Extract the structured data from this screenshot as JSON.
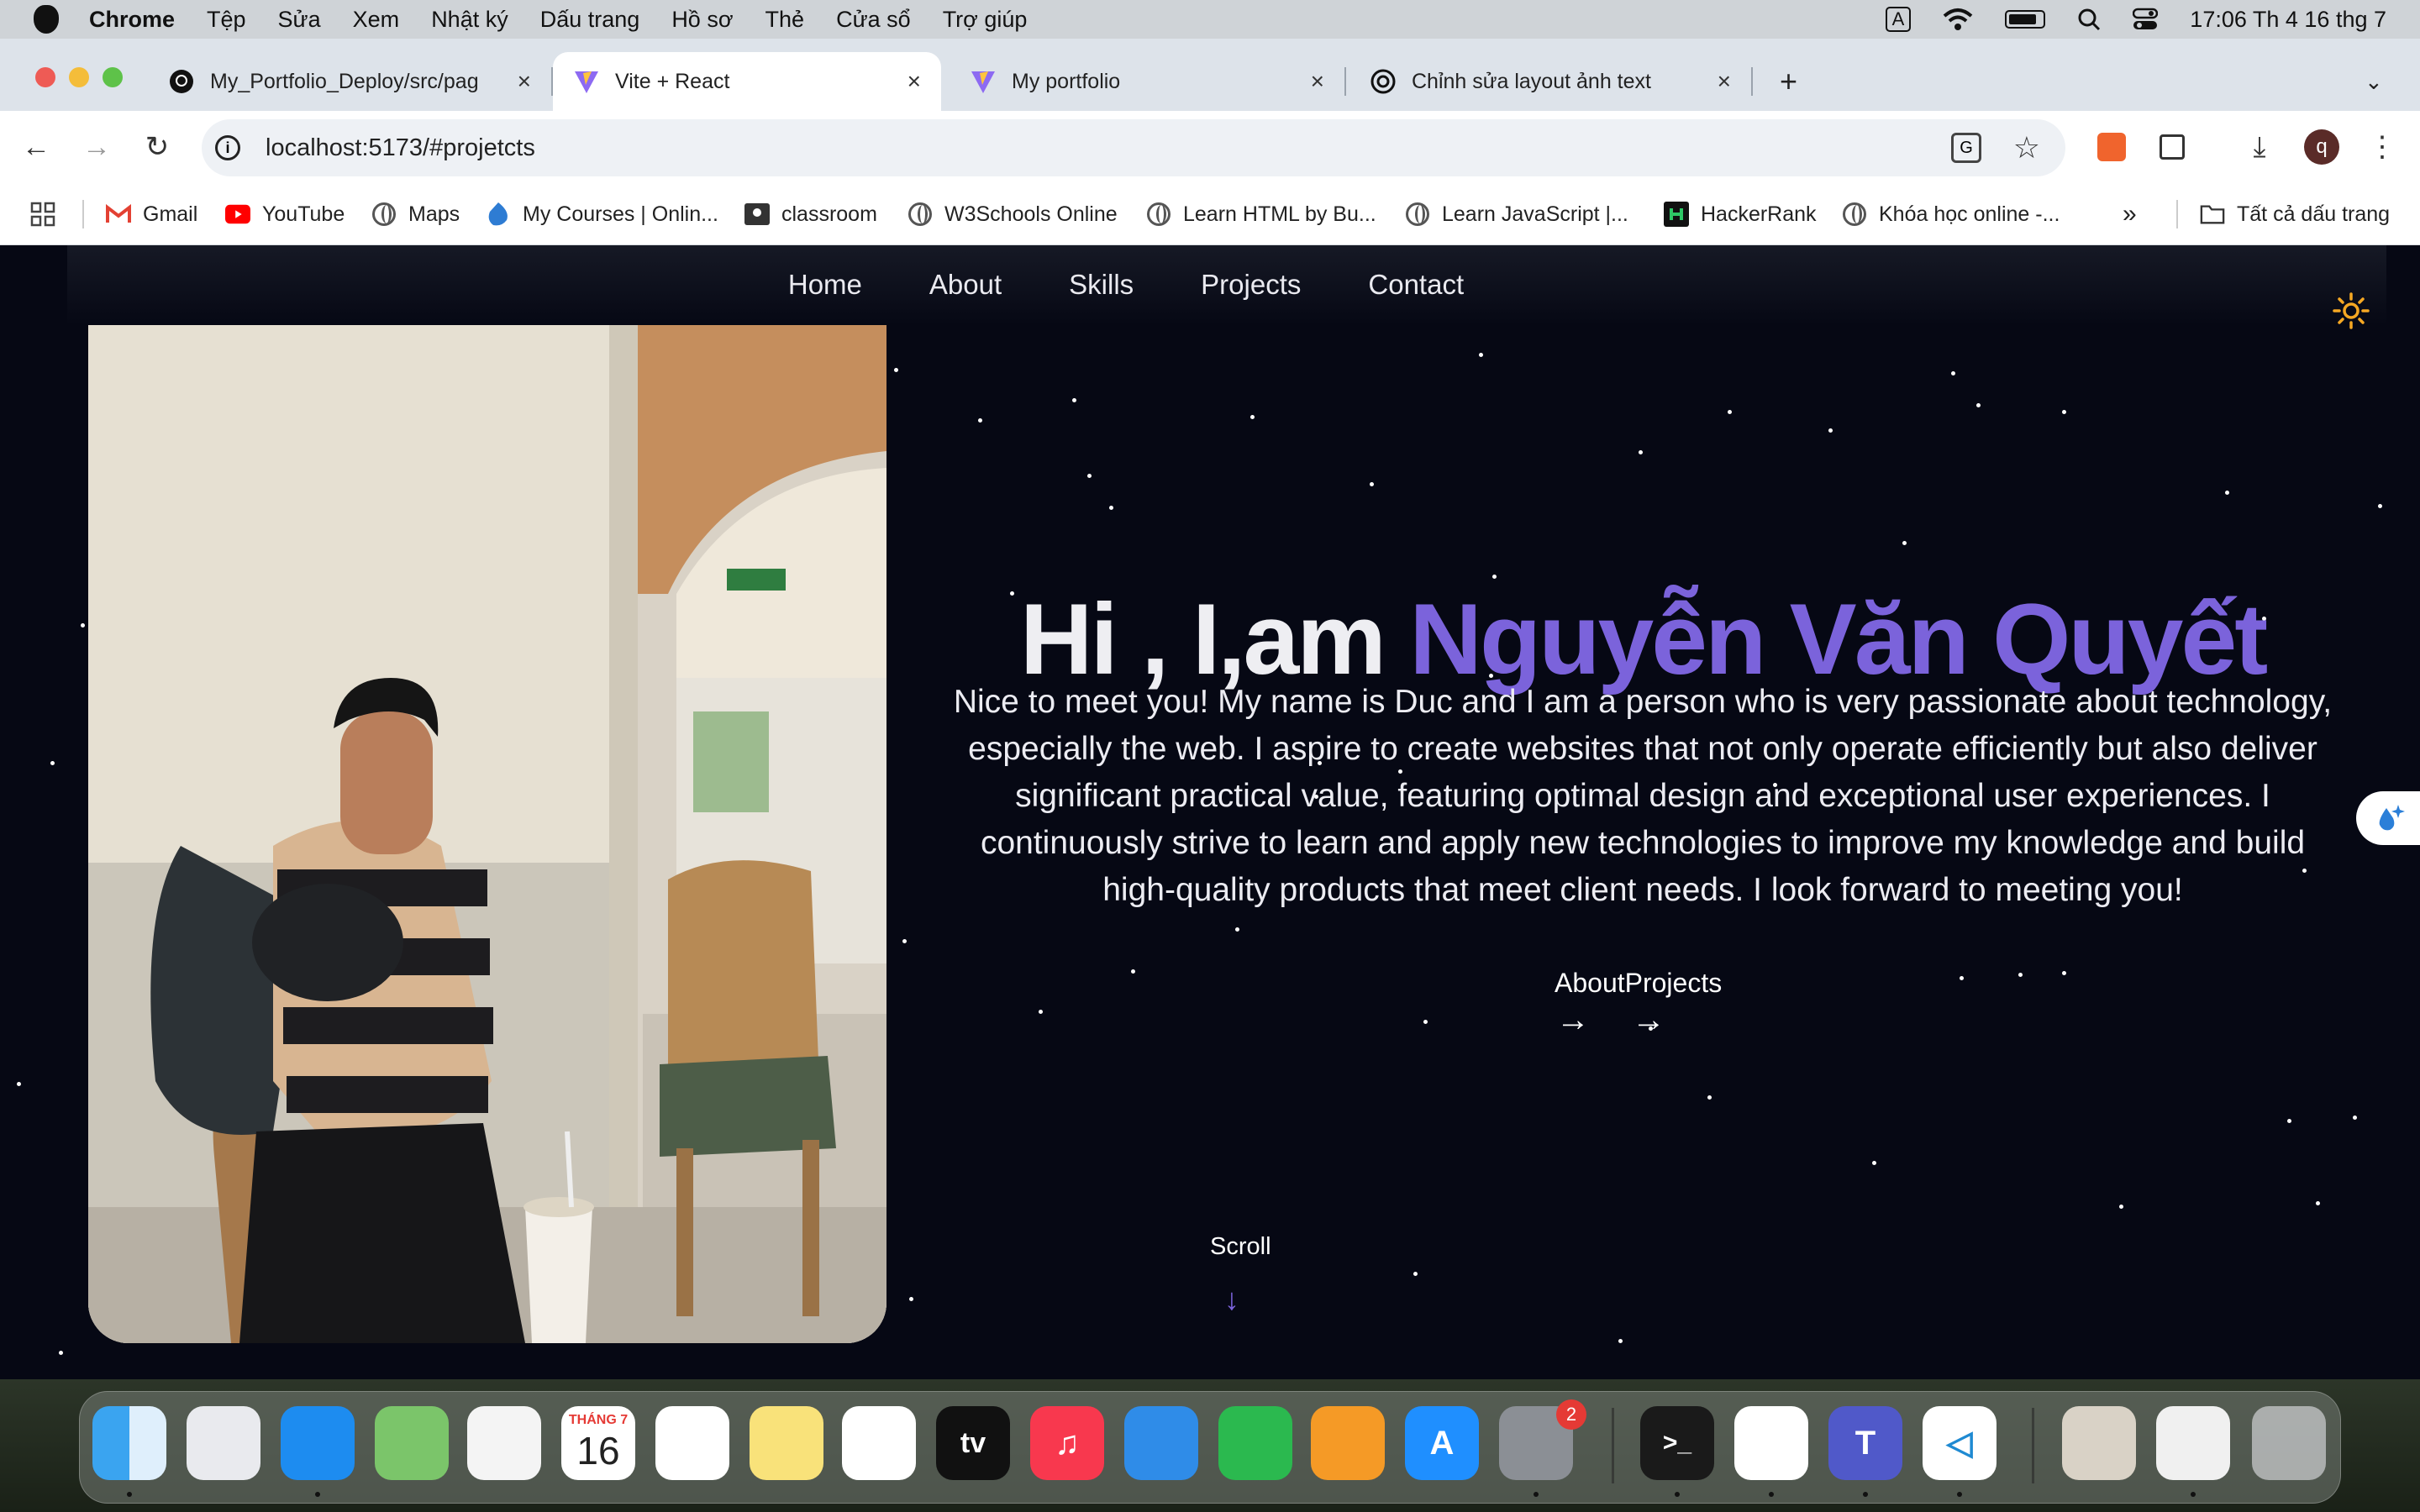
{
  "menubar": {
    "app": "Chrome",
    "items": [
      "Tệp",
      "Sửa",
      "Xem",
      "Nhật ký",
      "Dấu trang",
      "Hồ sơ",
      "Thẻ",
      "Cửa sổ",
      "Trợ giúp"
    ],
    "input_indicator": "A",
    "clock": "17:06 Th 4 16 thg 7"
  },
  "tabs": [
    {
      "title": "My_Portfolio_Deploy/src/pag",
      "icon": "github-icon"
    },
    {
      "title": "Vite + React",
      "icon": "vite-icon"
    },
    {
      "title": "My portfolio",
      "icon": "vite-icon"
    },
    {
      "title": "Chỉnh sửa layout ảnh text",
      "icon": "chatgpt-icon"
    }
  ],
  "toolbar": {
    "url": "localhost:5173/#projetcts",
    "profile_initial": "q"
  },
  "bookmarks": [
    {
      "label": "Gmail",
      "icon": "gmail-icon"
    },
    {
      "label": "YouTube",
      "icon": "youtube-icon"
    },
    {
      "label": "Maps",
      "icon": "globe-icon"
    },
    {
      "label": "My Courses | Onlin...",
      "icon": "drupal-icon"
    },
    {
      "label": "classroom",
      "icon": "classroom-icon"
    },
    {
      "label": "W3Schools Online",
      "icon": "globe-icon"
    },
    {
      "label": "Learn HTML by Bu...",
      "icon": "globe-icon"
    },
    {
      "label": "Learn JavaScript |...",
      "icon": "globe-icon"
    },
    {
      "label": "HackerRank",
      "icon": "hackerrank-icon"
    },
    {
      "label": "Khóa học online -...",
      "icon": "globe-icon"
    }
  ],
  "bookmarks_more": "»",
  "all_bookmarks": "Tất cả dấu trang",
  "site": {
    "nav": [
      "Home",
      "About",
      "Skills",
      "Projects",
      "Contact"
    ],
    "greeting": "Hi , I,am ",
    "name": "Nguyễn Văn Quyết",
    "description": "Nice to meet you! My name is Duc and I am a person who is very passionate about technology, especially the web. I aspire to create websites that not only operate efficiently but also deliver significant practical value, featuring optimal design and exceptional user experiences. I continuously strive to learn and apply new technologies to improve my knowledge and build high-quality products that meet client needs. I look forward to meeting you!",
    "link_about": "About",
    "link_projects": "Projects",
    "scroll_label": "Scroll",
    "accent_color": "#7b63db",
    "background_color": "#060814"
  },
  "dock": {
    "calendar_month": "THÁNG 7",
    "calendar_day": "16",
    "settings_badge": "2",
    "apps": [
      "finder",
      "launchpad",
      "safari",
      "maps",
      "photos",
      "calendar",
      "reminders",
      "notes",
      "freeform",
      "tv",
      "music",
      "keynote",
      "numbers",
      "pages",
      "app-store",
      "system-settings",
      "terminal",
      "chrome",
      "teams",
      "vscode",
      "preview",
      "chrome-window",
      "trash"
    ]
  }
}
